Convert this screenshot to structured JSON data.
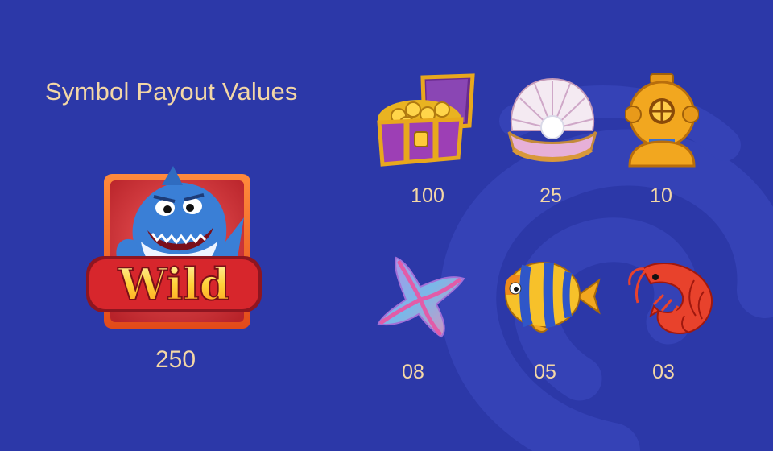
{
  "title": "Symbol Payout Values",
  "wild": {
    "icon": "shark-wild-icon",
    "label": "Wild",
    "value": "250"
  },
  "symbols": [
    {
      "icon": "treasure-chest-icon",
      "value": "100"
    },
    {
      "icon": "pearl-clam-icon",
      "value": "25"
    },
    {
      "icon": "diving-helmet-icon",
      "value": "10"
    },
    {
      "icon": "starfish-icon",
      "value": "08"
    },
    {
      "icon": "tropical-fish-icon",
      "value": "05"
    },
    {
      "icon": "shrimp-icon",
      "value": "03"
    }
  ],
  "colors": {
    "background": "#2c38a8",
    "text": "#f3d7a6",
    "swirl": "#3441b5"
  }
}
